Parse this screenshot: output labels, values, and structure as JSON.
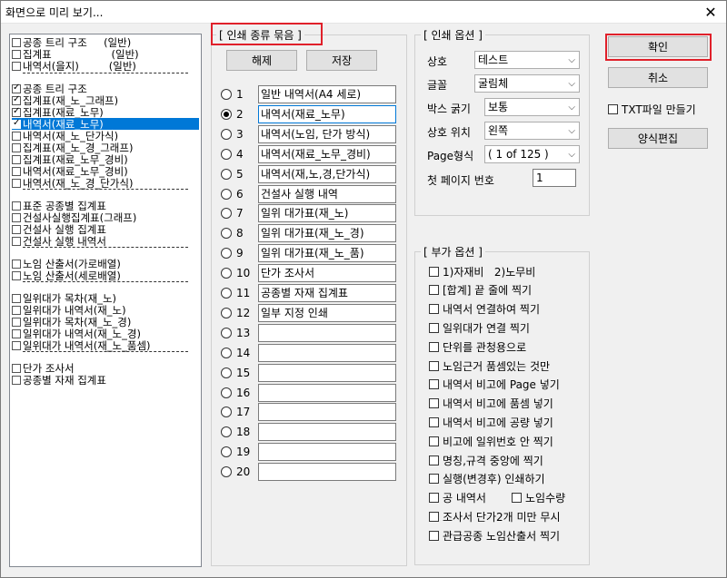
{
  "window": {
    "title": "화면으로 미리 보기...",
    "close_glyph": "✕"
  },
  "left_list": {
    "items": [
      {
        "label": "공종 트리 구조     (일반)",
        "checked": false,
        "selected": false
      },
      {
        "label": "집계표                  (일반)",
        "checked": false,
        "selected": false
      },
      {
        "label": "내역서(을지)         (일반)",
        "checked": false,
        "selected": false
      },
      {
        "label": "공종 트리 구조",
        "checked": true,
        "selected": false
      },
      {
        "label": "집계표(재_노_그래프)",
        "checked": true,
        "selected": false
      },
      {
        "label": "집계표(재료_노무)",
        "checked": true,
        "selected": false
      },
      {
        "label": "내역서(재료_노무)",
        "checked": true,
        "selected": true
      },
      {
        "label": "내역서(재_노_단가식)",
        "checked": false,
        "selected": false
      },
      {
        "label": "집계표(재_노_경_그래프)",
        "checked": false,
        "selected": false
      },
      {
        "label": "집계표(재료_노무_경비)",
        "checked": false,
        "selected": false
      },
      {
        "label": "내역서(재료_노무_경비)",
        "checked": false,
        "selected": false
      },
      {
        "label": "내역서(재_노_경_단가식)",
        "checked": false,
        "selected": false
      },
      {
        "label": "표준 공종별 집계표",
        "checked": false,
        "selected": false
      },
      {
        "label": "건설사실행집계표(그래프)",
        "checked": false,
        "selected": false
      },
      {
        "label": "건설사 실행 집계표",
        "checked": false,
        "selected": false
      },
      {
        "label": "건설사 실행 내역서",
        "checked": false,
        "selected": false
      },
      {
        "label": "노임 산출서(가로배열)",
        "checked": false,
        "selected": false
      },
      {
        "label": "노임 산출서(세로배열)",
        "checked": false,
        "selected": false
      },
      {
        "label": "일위대가 목차(재_노)",
        "checked": false,
        "selected": false
      },
      {
        "label": "일위대가 내역서(재_노)",
        "checked": false,
        "selected": false
      },
      {
        "label": "일위대가 목차(재_노_경)",
        "checked": false,
        "selected": false
      },
      {
        "label": "일위대가 내역서(재_노_경)",
        "checked": false,
        "selected": false
      },
      {
        "label": "일위대가 내역서(재_노_품셈)",
        "checked": false,
        "selected": false
      },
      {
        "label": "단가 조사서",
        "checked": false,
        "selected": false
      },
      {
        "label": "공종별 자재 집계표",
        "checked": false,
        "selected": false
      }
    ]
  },
  "print_types": {
    "group_label": "[ 인쇄 종류 묶음 ]",
    "clear_button": "해제",
    "save_button": "저장",
    "rows": [
      {
        "num": "1",
        "value": "일반 내역서(A4 세로)",
        "selected": false
      },
      {
        "num": "2",
        "value": "내역서(재료_노무)",
        "selected": true
      },
      {
        "num": "3",
        "value": "내역서(노임, 단가 방식)",
        "selected": false
      },
      {
        "num": "4",
        "value": "내역서(재료_노무_경비)",
        "selected": false
      },
      {
        "num": "5",
        "value": "내역서(재,노,경,단가식)",
        "selected": false
      },
      {
        "num": "6",
        "value": "건설사 실행 내역",
        "selected": false
      },
      {
        "num": "7",
        "value": "일위 대가표(재_노)",
        "selected": false
      },
      {
        "num": "8",
        "value": "일위 대가표(재_노_경)",
        "selected": false
      },
      {
        "num": "9",
        "value": "일위 대가표(재_노_품)",
        "selected": false
      },
      {
        "num": "10",
        "value": "단가 조사서",
        "selected": false
      },
      {
        "num": "11",
        "value": "공종별 자재 집계표",
        "selected": false
      },
      {
        "num": "12",
        "value": "일부 지정 인쇄",
        "selected": false
      },
      {
        "num": "13",
        "value": "",
        "selected": false
      },
      {
        "num": "14",
        "value": "",
        "selected": false
      },
      {
        "num": "15",
        "value": "",
        "selected": false
      },
      {
        "num": "16",
        "value": "",
        "selected": false
      },
      {
        "num": "17",
        "value": "",
        "selected": false
      },
      {
        "num": "18",
        "value": "",
        "selected": false
      },
      {
        "num": "19",
        "value": "",
        "selected": false
      },
      {
        "num": "20",
        "value": "",
        "selected": false
      }
    ]
  },
  "print_options": {
    "group_label": "[ 인쇄 옵션 ]",
    "company_label": "상호",
    "company_value": "테스트",
    "font_label": "글꼴",
    "font_value": "굴림체",
    "box_label": "박스 굵기",
    "box_value": "보통",
    "position_label": "상호 위치",
    "position_value": "왼쪽",
    "page_label": "Page형식",
    "page_value": "( 1 of 125 )",
    "first_page_label": "첫 페이지 번호",
    "first_page_value": "1"
  },
  "extra_options": {
    "group_label": "[ 부가 옵션 ]",
    "items": [
      "1)자재비   2)노무비",
      "[합계] 끝 줄에 찍기",
      "내역서 연결하여 찍기",
      "일위대가 연결 찍기",
      "단위를 관청용으로",
      "노임근거 품셈있는 것만",
      "내역서 비고에 Page 넣기",
      "내역서 비고에 품셈 넣기",
      "내역서 비고에 공량 넣기",
      "비고에 일위번호 안 찍기",
      "명칭,규격 중앙에 찍기",
      "실행(변경후) 인쇄하기",
      "공 내역서",
      "조사서 단가2개 미만 무시",
      "관급공종 노임산출서 찍기"
    ],
    "labor_qty_label": "노임수량"
  },
  "buttons": {
    "ok": "확인",
    "cancel": "취소",
    "txt_label": "TXT파일 만들기",
    "form_edit": "양식편집"
  }
}
